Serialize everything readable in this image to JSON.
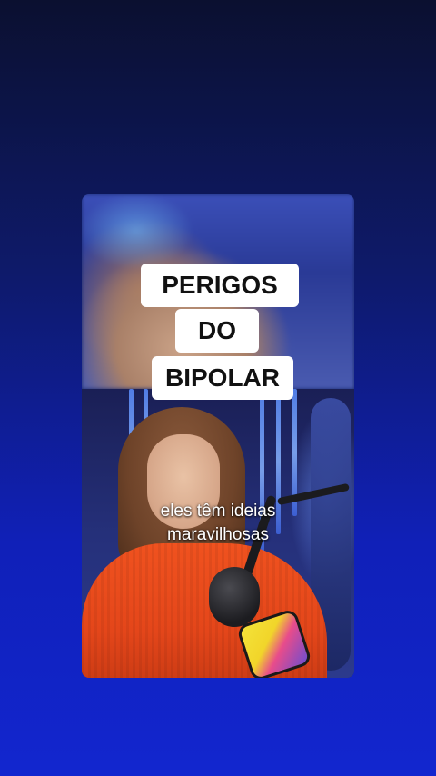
{
  "overlay_title": {
    "line1": "PERIGOS",
    "line2": "DO",
    "line3": "BIPOLAR"
  },
  "caption": {
    "line1": "eles têm ideias",
    "line2": "maravilhosas"
  },
  "colors": {
    "background_top": "#0b1030",
    "background_bottom": "#1226cf",
    "title_box": "#ffffff",
    "title_text": "#111111",
    "sweater": "#f0521f",
    "caption_text": "#ffffff"
  }
}
